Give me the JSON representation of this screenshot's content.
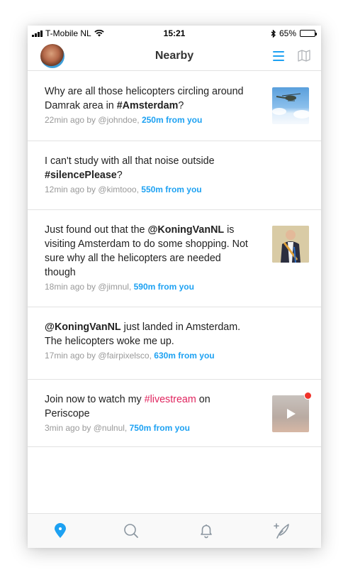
{
  "status_bar": {
    "carrier": "T-Mobile NL",
    "time": "15:21",
    "battery": "65%",
    "battery_level": 0.65
  },
  "nav": {
    "title": "Nearby",
    "avatar_icon": "user-avatar",
    "list_icon": "list-icon",
    "map_icon": "map-icon",
    "accent_color": "#1da1f2"
  },
  "feed": {
    "items": [
      {
        "text_before": "Why are all those helicopters circling around Damrak area in ",
        "text_bold": "#Amsterdam",
        "text_after": "?",
        "time": "22min ago by @johndoe,",
        "distance": "250m from you"
      },
      {
        "text_before": "I can't study with all that noise outside ",
        "text_bold": "#silencePlease",
        "text_after": "?",
        "time": "12min ago by @kimtooo,",
        "distance": "550m from you"
      },
      {
        "text_before": "Just found out that the ",
        "text_bold": "@KoningVanNL",
        "text_after": " is visiting Amsterdam to do some shopping. Not sure why all the helicopters are needed though",
        "time": "18min ago by @jimnul,",
        "distance": "590m from you"
      },
      {
        "text_before": "",
        "text_bold": "@KoningVanNL",
        "text_after": " just landed in Amsterdam. The helicopters woke me up.",
        "time": "17min ago by @fairpixelsco,",
        "distance": "630m from you"
      },
      {
        "text_before": "Join now to watch my ",
        "text_live": "#livestream",
        "text_after": " on Periscope",
        "time": "3min ago by @nulnul,",
        "distance": "750m from you"
      }
    ]
  },
  "tab_bar": {
    "tabs": [
      "location-pin-icon",
      "search-icon",
      "bell-icon",
      "compose-feather-icon"
    ],
    "active_tab": "location-pin-icon"
  }
}
